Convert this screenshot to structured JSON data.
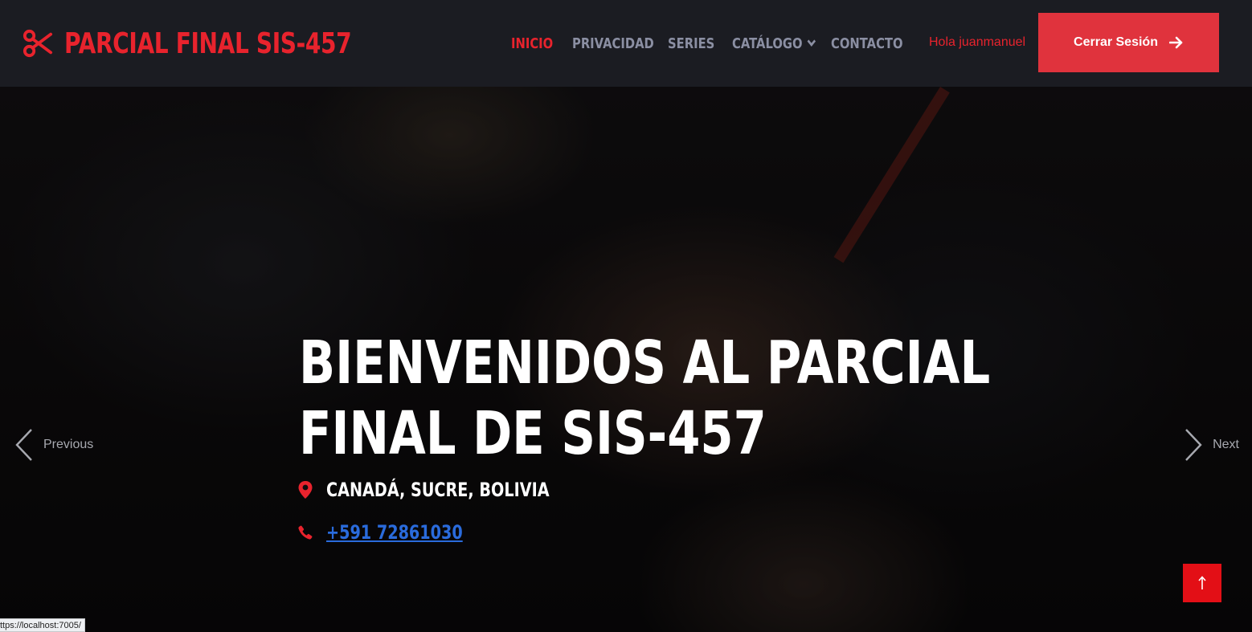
{
  "brand": {
    "title": "PARCIAL FINAL SIS-457",
    "icon": "scissors-icon",
    "color": "#e8232d"
  },
  "nav": {
    "items": [
      {
        "label": "INICIO",
        "active": true
      },
      {
        "label": "PRIVACIDAD",
        "active": false
      },
      {
        "label": "SERIES",
        "active": false
      },
      {
        "label": "CATÁLOGO",
        "active": false,
        "dropdown": true
      },
      {
        "label": "CONTACTO",
        "active": false
      }
    ]
  },
  "user": {
    "greeting": "Hola juanmanuel",
    "logout_label": "Cerrar Sesión",
    "logout_icon": "arrow-right-icon"
  },
  "hero": {
    "title_line1": "BIENVENIDOS AL PARCIAL",
    "title_line2": "FINAL DE SIS-457",
    "location": "CANADÁ, SUCRE, BOLIVIA",
    "phone": "+591 72861030"
  },
  "carousel": {
    "prev_label": "Previous",
    "next_label": "Next"
  },
  "back_to_top": {
    "icon": "arrow-up-icon"
  },
  "status_bar": {
    "url": "ttps://localhost:7005/"
  },
  "colors": {
    "accent": "#e8232d",
    "topbar": "#1b1c22",
    "link": "#2a6bdc"
  }
}
